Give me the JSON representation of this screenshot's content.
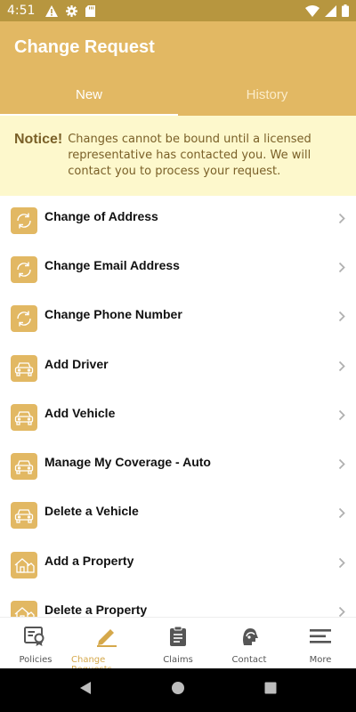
{
  "status_bar": {
    "time": "4:51",
    "left_icons": [
      "warning-icon",
      "gear-icon",
      "sd-card-icon"
    ],
    "right_icons": [
      "wifi-icon",
      "signal-icon",
      "battery-icon"
    ]
  },
  "app_bar": {
    "title": "Change Request",
    "tabs": [
      {
        "label": "New",
        "active": true
      },
      {
        "label": "History",
        "active": false
      }
    ]
  },
  "notice": {
    "title": "Notice!",
    "text": "Changes cannot be bound until a licensed representative has contacted you. We will contact you to process your request."
  },
  "list": {
    "items": [
      {
        "label": "Change of Address",
        "icon": "refresh-icon"
      },
      {
        "label": "Change Email Address",
        "icon": "refresh-icon"
      },
      {
        "label": "Change Phone Number",
        "icon": "refresh-icon"
      },
      {
        "label": "Add Driver",
        "icon": "car-icon"
      },
      {
        "label": "Add Vehicle",
        "icon": "car-icon"
      },
      {
        "label": "Manage My Coverage - Auto",
        "icon": "car-icon"
      },
      {
        "label": "Delete a Vehicle",
        "icon": "car-icon"
      },
      {
        "label": "Add a Property",
        "icon": "house-icon"
      },
      {
        "label": "Delete a Property",
        "icon": "house-icon"
      }
    ]
  },
  "bottom_nav": {
    "items": [
      {
        "label": "Policies",
        "icon": "policy-icon"
      },
      {
        "label": "Change Requests",
        "icon": "pencil-icon",
        "active": true
      },
      {
        "label": "Claims",
        "icon": "clipboard-icon"
      },
      {
        "label": "Contact",
        "icon": "headset-icon"
      },
      {
        "label": "More",
        "icon": "menu-icon"
      }
    ]
  },
  "colors": {
    "primary": "#e2b863",
    "status_bar": "#b7963f",
    "notice_bg": "#fdf8cc",
    "notice_text": "#7a6028"
  }
}
